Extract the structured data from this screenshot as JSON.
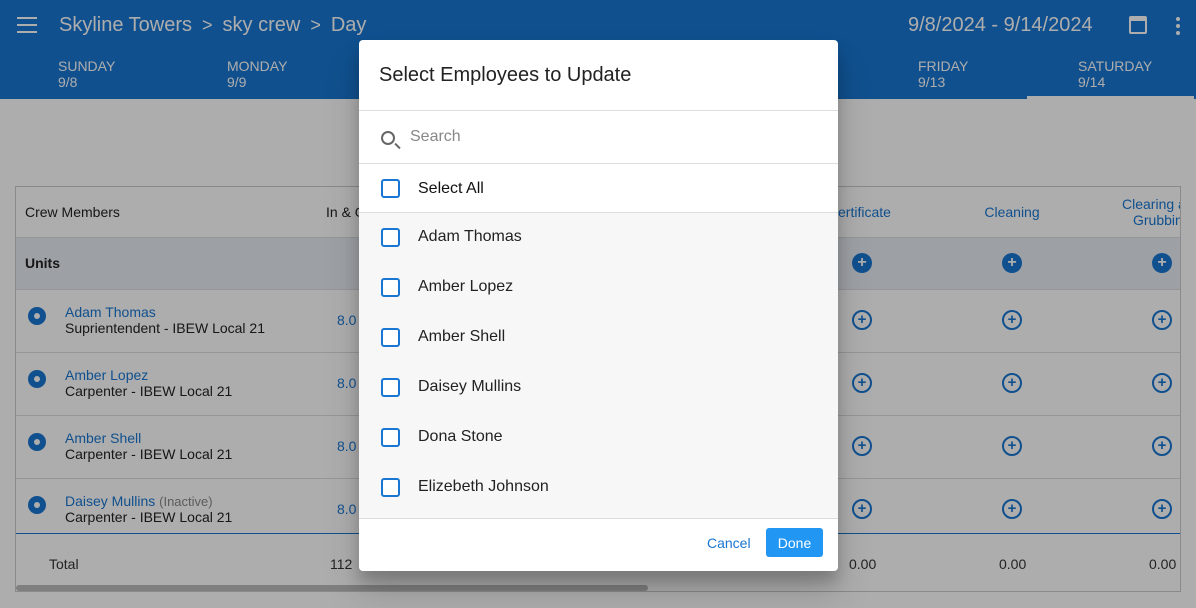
{
  "header": {
    "breadcrumb": [
      "Skyline Towers",
      "sky crew",
      "Day"
    ],
    "breadcrumb_sep": ">",
    "date_range": "9/8/2024 - 9/14/2024"
  },
  "day_tabs": [
    {
      "day": "SUNDAY",
      "date": "9/8"
    },
    {
      "day": "MONDAY",
      "date": "9/9"
    },
    {
      "day": "FRIDAY",
      "date": "9/13"
    },
    {
      "day": "SATURDAY",
      "date": "9/14"
    }
  ],
  "grid": {
    "header": {
      "crew_members": "Crew Members",
      "in_col": "In & O",
      "cost_codes": [
        "ertificate",
        "Cleaning",
        "Clearing a",
        "Grubbin"
      ]
    },
    "units_label": "Units",
    "rows": [
      {
        "name": "Adam Thomas",
        "role": "Suprientendent - IBEW Local 21",
        "hours": "8.0",
        "status": ""
      },
      {
        "name": "Amber Lopez",
        "role": "Carpenter - IBEW Local 21",
        "hours": "8.0",
        "status": ""
      },
      {
        "name": "Amber Shell",
        "role": "Carpenter - IBEW Local 21",
        "hours": "8.0",
        "status": ""
      },
      {
        "name": "Daisey Mullins",
        "role": "Carpenter - IBEW Local 21",
        "hours": "8.0",
        "status": "(Inactive)"
      }
    ],
    "total_label": "Total",
    "total_hours": "112",
    "totals": [
      "0.00",
      "0.00",
      "0.00"
    ]
  },
  "dialog": {
    "title": "Select Employees to Update",
    "search_placeholder": "Search",
    "select_all": "Select All",
    "employees": [
      "Adam Thomas",
      "Amber Lopez",
      "Amber Shell",
      "Daisey Mullins",
      "Dona Stone",
      "Elizebeth Johnson"
    ],
    "cancel_label": "Cancel",
    "done_label": "Done"
  },
  "colors": {
    "primary": "#1976d2",
    "done_button": "#2196f3"
  }
}
